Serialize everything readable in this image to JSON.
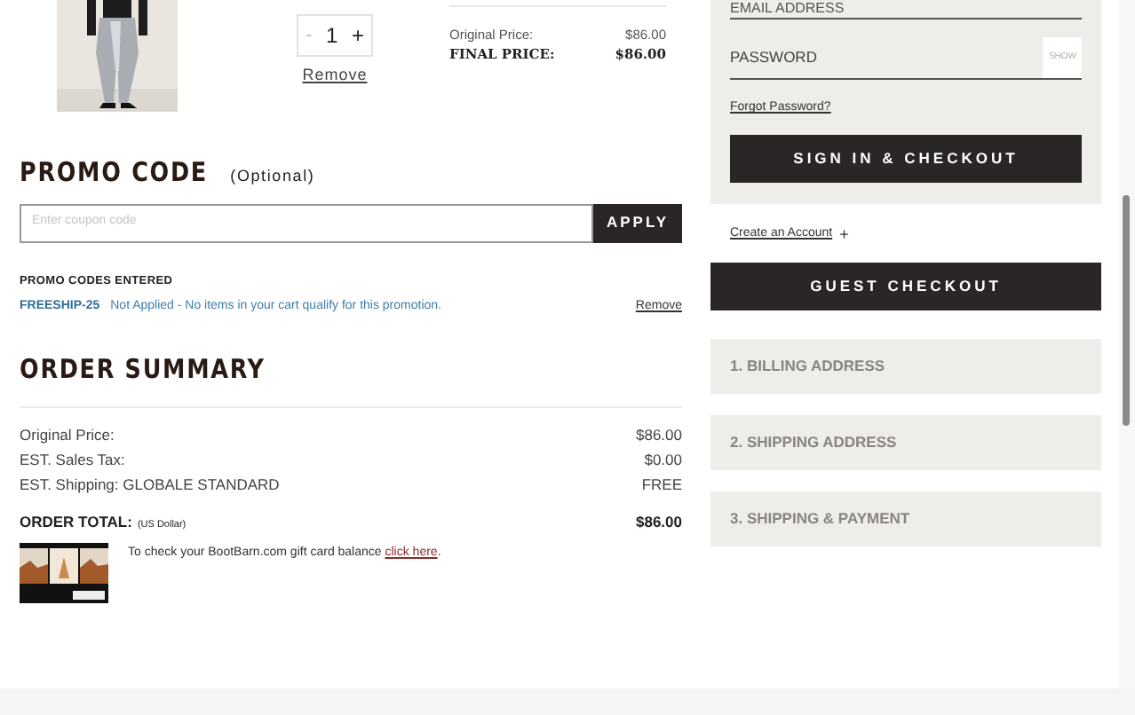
{
  "cart_item": {
    "quantity": {
      "decrease": "-",
      "value": "1",
      "increase": "+"
    },
    "remove": "Remove",
    "prices": [
      {
        "label": "Original Price:",
        "value": "$86.00",
        "kind": "regular"
      },
      {
        "label": "FINAL PRICE:",
        "value": "$86.00",
        "kind": "final"
      }
    ]
  },
  "promo": {
    "title": "PROMO CODE",
    "optional": "(Optional)",
    "placeholder": "Enter coupon code",
    "apply": "APPLY",
    "entered_title": "PROMO CODES ENTERED",
    "codes": [
      {
        "code": "FREESHIP-25",
        "message": "Not Applied - No items in your cart qualify for this promotion.",
        "remove": "Remove"
      }
    ]
  },
  "order_summary": {
    "title": "ORDER SUMMARY",
    "rows": [
      {
        "label": "Original Price:",
        "value": "$86.00"
      },
      {
        "label": "EST. Sales Tax:",
        "value": "$0.00"
      },
      {
        "label": "EST. Shipping: GLOBALE STANDARD",
        "value": "FREE"
      }
    ],
    "total": {
      "label": "ORDER TOTAL:",
      "currency": "(US Dollar)",
      "value": "$86.00"
    },
    "gift_card": {
      "text": "To check your BootBarn.com gift card balance",
      "link": "click here",
      "end": "."
    }
  },
  "sign_in": {
    "email_placeholder": "EMAIL ADDRESS",
    "password_placeholder": "PASSWORD",
    "show": "SHOW",
    "forgot": "Forgot Password?",
    "button": "SIGN IN & CHECKOUT"
  },
  "create_account": {
    "label": "Create an Account",
    "icon": "+"
  },
  "guest_checkout": "GUEST CHECKOUT",
  "steps": [
    "1. BILLING ADDRESS",
    "2. SHIPPING ADDRESS",
    "3. SHIPPING & PAYMENT"
  ]
}
